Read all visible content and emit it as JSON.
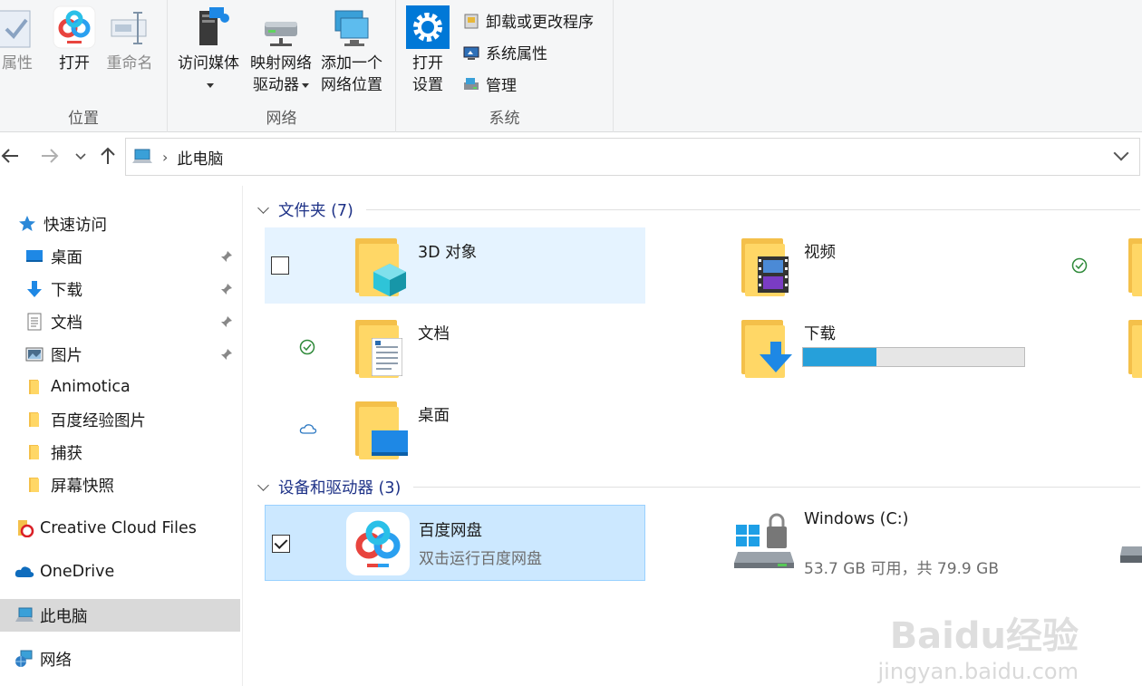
{
  "ribbon": {
    "groups": [
      {
        "label": "位置",
        "buttons": [
          {
            "label": "属性"
          },
          {
            "label": "打开"
          },
          {
            "label": "重命名"
          }
        ]
      },
      {
        "label": "网络",
        "buttons": [
          {
            "label": "访问媒体"
          },
          {
            "label": "映射网络",
            "label2": "驱动器"
          },
          {
            "label": "添加一个",
            "label2": "网络位置"
          }
        ]
      },
      {
        "label": "系统",
        "buttons": [
          {
            "label": "打开",
            "label2": "设置"
          }
        ]
      }
    ],
    "system_small": [
      {
        "label": "卸载或更改程序"
      },
      {
        "label": "系统属性"
      },
      {
        "label": "管理"
      }
    ]
  },
  "address": {
    "crumb": "此电脑"
  },
  "sidebar": {
    "items": [
      {
        "label": "快速访问"
      },
      {
        "label": "桌面"
      },
      {
        "label": "下载"
      },
      {
        "label": "文档"
      },
      {
        "label": "图片"
      },
      {
        "label": "Animotica"
      },
      {
        "label": "百度经验图片"
      },
      {
        "label": "捕获"
      },
      {
        "label": "屏幕快照"
      },
      {
        "label": "Creative Cloud Files"
      },
      {
        "label": "OneDrive"
      },
      {
        "label": "此电脑"
      },
      {
        "label": "网络"
      }
    ]
  },
  "main": {
    "folders_header": "文件夹 (7)",
    "folders": [
      {
        "name": "3D 对象"
      },
      {
        "name": "视频"
      },
      {
        "name": "文档"
      },
      {
        "name": "下载"
      },
      {
        "name": "桌面"
      }
    ],
    "devices_header": "设备和驱动器 (3)",
    "devices": [
      {
        "name": "百度网盘",
        "sub": "双击运行百度网盘"
      },
      {
        "name": "Windows (C:)",
        "sub": "53.7 GB 可用，共 79.9 GB",
        "used_fraction": 0.33
      }
    ]
  },
  "watermark": {
    "main": "Baidu经验",
    "sub": "jingyan.baidu.com"
  },
  "colors": {
    "accent": "#26a0da",
    "selected": "#cce8ff",
    "hover": "#e5f3ff",
    "header_text": "#1e3287"
  }
}
